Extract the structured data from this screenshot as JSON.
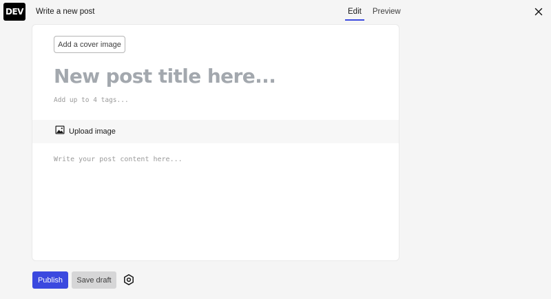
{
  "header": {
    "logo_text": "DEV",
    "page_title": "Write a new post",
    "tabs": [
      {
        "label": "Edit",
        "active": true
      },
      {
        "label": "Preview",
        "active": false
      }
    ],
    "close_icon": "close-icon"
  },
  "editor": {
    "cover_button_label": "Add a cover image",
    "title_placeholder": "New post title here...",
    "tags_placeholder": "Add up to 4 tags...",
    "toolbar": {
      "upload_label": "Upload image",
      "upload_icon": "image-icon"
    },
    "body_placeholder": "Write your post content here..."
  },
  "footer": {
    "publish_label": "Publish",
    "save_draft_label": "Save draft",
    "settings_icon": "settings-hexagon-icon"
  },
  "colors": {
    "accent": "#3b49df",
    "background": "#f5f5f5",
    "placeholder": "#a3a8ae"
  }
}
